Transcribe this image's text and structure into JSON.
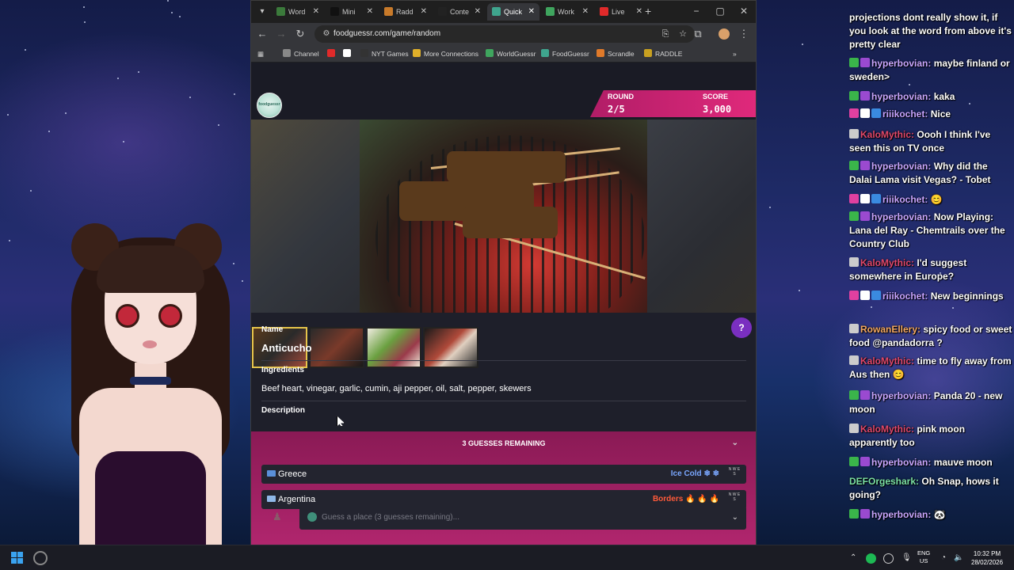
{
  "browser": {
    "tabs": [
      {
        "label": "Word",
        "color": "#3b7a3b"
      },
      {
        "label": "Mini",
        "color": "#111111"
      },
      {
        "label": "Radd",
        "color": "#c87a2a"
      },
      {
        "label": "Conte",
        "color": "#222222"
      },
      {
        "label": "Quick",
        "color": "#3fa58e",
        "active": true
      },
      {
        "label": "Work",
        "color": "#3fa55e"
      },
      {
        "label": "Live",
        "color": "#e02a2a"
      }
    ],
    "url": "foodguessr.com/game/random",
    "bookmarks": [
      {
        "label": "Channel",
        "color": "#888888"
      },
      {
        "label": "",
        "color": "#e02a2a"
      },
      {
        "label": "",
        "color": "#ffffff"
      },
      {
        "label": "NYT Games",
        "color": "#333333"
      },
      {
        "label": "More Connections",
        "color": "#e0b02a"
      },
      {
        "label": "WorldGuessr",
        "color": "#3fa55e"
      },
      {
        "label": "FoodGuessr",
        "color": "#3fa58e"
      },
      {
        "label": "Scrandle",
        "color": "#e07a2a"
      },
      {
        "label": "RADDLE",
        "color": "#c8a020"
      }
    ]
  },
  "game": {
    "logo_text": "foodguessr",
    "round_label": "ROUND",
    "round_value": "2/5",
    "score_label": "SCORE",
    "score_value": "3,000",
    "name_label": "Name",
    "name_value": "Anticucho",
    "ingredients_label": "Ingredients",
    "ingredients_value": "Beef heart, vinegar, garlic, cumin, aji pepper, oil, salt, pepper, skewers",
    "description_label": "Description",
    "guesses_remaining_label": "3 GUESSES REMAINING",
    "guesses": [
      {
        "country": "Greece",
        "hint": "Ice Cold",
        "hint_icons": "❄ ❄",
        "hint_color": "#7aa7ff",
        "flag_color": "#5a8fd8"
      },
      {
        "country": "Argentina",
        "hint": "Borders",
        "hint_icons": "🔥 🔥 🔥",
        "hint_color": "#ff5a3a",
        "flag_color": "#8fb8e8"
      }
    ],
    "compass_letters": "N W E S",
    "input_placeholder": "Guess a place (3 guesses remaining)..."
  },
  "chat": [
    {
      "user": "",
      "text": "projections dont really show it, if you look at the word from above it's pretty clear",
      "cls": "",
      "badges": []
    },
    {
      "user": "hyperbovian:",
      "text": "maybe finland or sweden>",
      "cls": "u-hyper",
      "badges": [
        "#3ab54a",
        "#9a4ad0"
      ]
    },
    {
      "user": "hyperbovian:",
      "text": "kaka",
      "cls": "u-hyper",
      "badges": [
        "#3ab54a",
        "#9a4ad0"
      ]
    },
    {
      "user": "riiikochet:",
      "text": "Nice",
      "cls": "u-rili",
      "badges": [
        "#e040a0",
        "#ffffff",
        "#3a8ae0"
      ]
    },
    {
      "user": "KaloMythic:",
      "text": "Oooh I think I've seen this on TV once",
      "cls": "u-kalo",
      "badges": [
        "#cccccc"
      ]
    },
    {
      "user": "hyperbovian:",
      "text": "Why did the Dalai Lama visit Vegas? - Tobet",
      "cls": "u-hyper",
      "badges": [
        "#3ab54a",
        "#9a4ad0"
      ]
    },
    {
      "user": "riiikochet:",
      "text": "😊",
      "cls": "u-rili",
      "badges": [
        "#e040a0",
        "#ffffff",
        "#3a8ae0"
      ]
    },
    {
      "user": "hyperbovian:",
      "text": "Now Playing: Lana del Ray - Chemtrails over the Country Club",
      "cls": "u-hyper",
      "badges": [
        "#3ab54a",
        "#9a4ad0"
      ]
    },
    {
      "user": "KaloMythic:",
      "text": "I'd suggest somewhere in Europe?",
      "cls": "u-kalo",
      "badges": [
        "#cccccc"
      ]
    },
    {
      "user": "riiikochet:",
      "text": "New beginnings",
      "cls": "u-rili",
      "badges": [
        "#e040a0",
        "#ffffff",
        "#3a8ae0"
      ]
    },
    {
      "user": "RowanEllery:",
      "text": "spicy food or sweet food @pandadorra ?",
      "cls": "u-rowan",
      "badges": [
        "#cccccc"
      ]
    },
    {
      "user": "KaloMythic:",
      "text": "time to fly away from Aus then 😊",
      "cls": "u-kalo",
      "badges": [
        "#cccccc"
      ]
    },
    {
      "user": "hyperbovian:",
      "text": "Panda 20 - new moon",
      "cls": "u-hyper",
      "badges": [
        "#3ab54a",
        "#9a4ad0"
      ]
    },
    {
      "user": "KaloMythic:",
      "text": "pink moon apparently too",
      "cls": "u-kalo",
      "badges": [
        "#cccccc"
      ]
    },
    {
      "user": "hyperbovian:",
      "text": "mauve moon",
      "cls": "u-hyper",
      "badges": [
        "#3ab54a",
        "#9a4ad0"
      ]
    },
    {
      "user": "DEFOrgeshark:",
      "text": "Oh Snap, hows it going?",
      "cls": "u-def",
      "badges": []
    },
    {
      "user": "hyperbovian:",
      "text": "🐼",
      "cls": "u-hyper",
      "badges": [
        "#3ab54a",
        "#9a4ad0"
      ]
    }
  ],
  "taskbar": {
    "lang_top": "ENG",
    "lang_bottom": "US",
    "time": "10:32 PM",
    "date": "28/02/2026"
  }
}
